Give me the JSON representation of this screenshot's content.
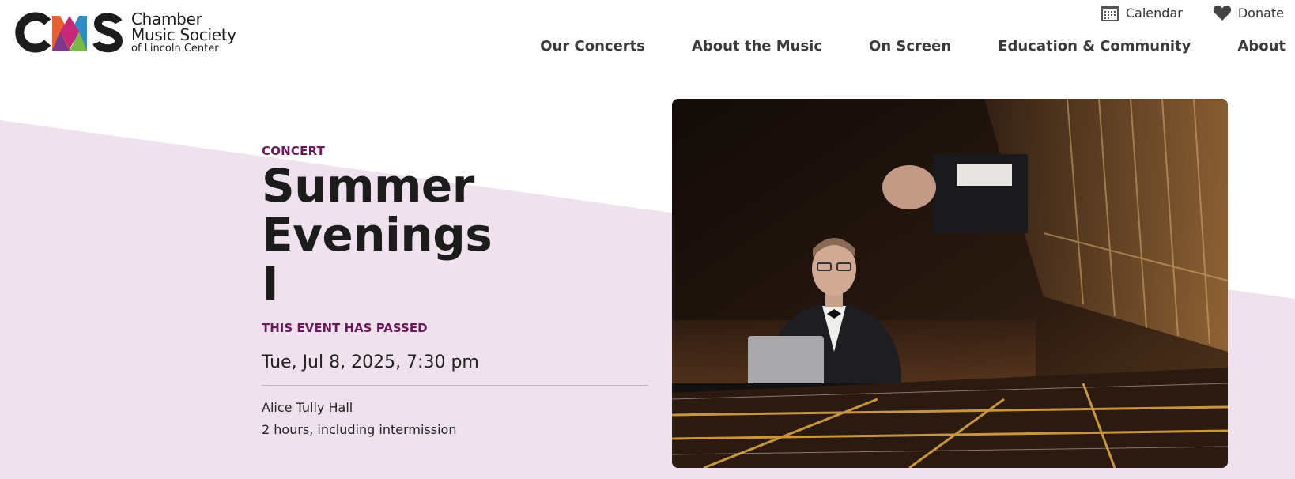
{
  "logo": {
    "mark": "CMS",
    "line1": "Chamber",
    "line2": "Music Society",
    "line3": "of Lincoln Center"
  },
  "utility": {
    "calendar_label": "Calendar",
    "calendar_icon": "calendar-icon",
    "donate_label": "Donate",
    "donate_icon": "heart-icon"
  },
  "nav": {
    "items": [
      {
        "label": "Our Concerts"
      },
      {
        "label": "About the Music"
      },
      {
        "label": "On Screen"
      },
      {
        "label": "Education & Community"
      },
      {
        "label": "About"
      }
    ]
  },
  "event": {
    "type": "CONCERT",
    "title_line1": "Summer Evenings",
    "title_line2": "I",
    "status": "THIS EVENT HAS PASSED",
    "datetime": "Tue, Jul 8, 2025, 7:30 pm",
    "venue": "Alice Tully Hall",
    "duration": "2 hours, including intermission"
  },
  "colors": {
    "accent": "#6a1a5c",
    "band": "#efe2ee",
    "text": "#1c1c1c"
  }
}
